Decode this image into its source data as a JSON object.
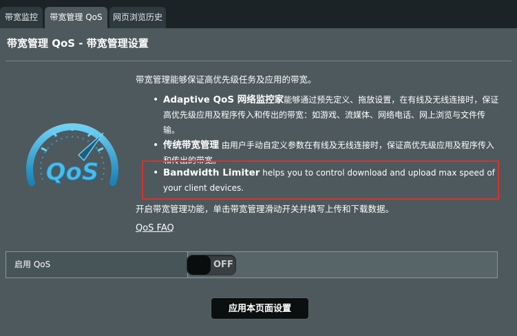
{
  "tabs": [
    {
      "label": "带宽监控"
    },
    {
      "label": "带宽管理 QoS"
    },
    {
      "label": "网页浏览历史"
    }
  ],
  "page_title": "带宽管理 QoS - 带宽管理设置",
  "description": "带宽管理能够保证高优先级任务及应用的带宽。",
  "features": [
    {
      "title": "Adaptive QoS 网络监控家",
      "text": "能够通过预先定义、拖放设置，在有线及无线连接时，保证高优先级应用及程序传入和传出的带宽：如游戏、流媒体、网络电话、网上浏览与文件传输。"
    },
    {
      "title": "传统带宽管理",
      "text": "由用户手动自定义参数在有线及无线连接时，保证高优先级应用及程序传入和传出的带宽。"
    },
    {
      "title": "Bandwidth Limiter",
      "text": "helps you to control download and upload max speed of your client devices."
    }
  ],
  "instructions": "开启带宽管理功能，单击带宽管理滑动开关并填写上传和下载数据。",
  "faq_link": "QoS FAQ",
  "logo_text": "QoS",
  "setting": {
    "label": "启用 QoS",
    "toggle_state": "OFF"
  },
  "apply_button": "应用本页面设置",
  "colors": {
    "accent": "#2fa3d8",
    "background": "#4d595d",
    "highlight": "#d93131"
  }
}
